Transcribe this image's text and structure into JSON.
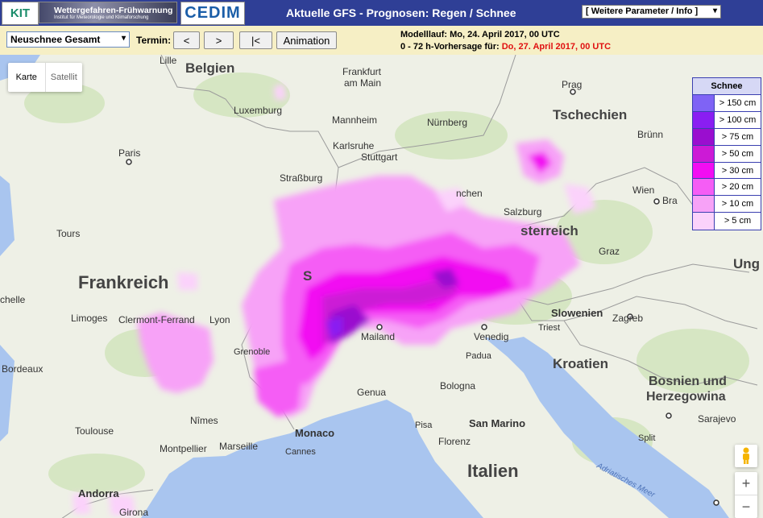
{
  "header": {
    "kit_logo": "KIT",
    "wf_logo": "Wettergefahren-Frühwarnung",
    "wf_sub": "Institut für Meteorologie und Klimaforschung",
    "cedim_logo": "CEDIM",
    "title": "Aktuelle GFS - Prognosen: Regen / Schnee",
    "param_select": "[ Weitere Parameter / Info ]"
  },
  "toolbar": {
    "product_select": "Neuschnee Gesamt",
    "termin_label": "Termin:",
    "btn_prev": "<",
    "btn_next": ">",
    "btn_first": "|<",
    "btn_animation": "Animation",
    "modelllauf_label": "Modelllauf: Mo, 24. April 2017, 00 UTC",
    "vorhersage_label": "0 - 72 h-Vorhersage für:",
    "vorhersage_value": "Do, 27. April 2017, 00 UTC"
  },
  "map": {
    "maptype_karte": "Karte",
    "maptype_satellit": "Satellit",
    "labels": {
      "belgien": "Belgien",
      "lille": "Lille",
      "luxemburg": "Luxemburg",
      "frankfurt1": "Frankfurt",
      "frankfurt2": "am Main",
      "prag": "Prag",
      "tschechien": "Tschechien",
      "mannheim": "Mannheim",
      "nurnberg": "Nürnberg",
      "karlsruhe": "Karlsruhe",
      "stuttgart": "Stuttgart",
      "brunn": "Brünn",
      "paris": "Paris",
      "strassburg": "Straßburg",
      "munchen": "nchen",
      "wien": "Wien",
      "bra": "Bra",
      "salzburg": "Salzburg",
      "osterreich": "sterreich",
      "tours": "Tours",
      "graz": "Graz",
      "ung": "Ung",
      "frankreich": "Frankreich",
      "s": "S",
      "chelle": "chelle",
      "slowenien": "Slowenien",
      "limoges": "Limoges",
      "clermont": "Clermont-Ferrand",
      "lyon": "Lyon",
      "triest": "Triest",
      "zagreb": "Zagreb",
      "venedig": "Venedig",
      "mailand": "Mailand",
      "padua": "Padua",
      "grenoble": "Grenoble",
      "bordeaux": "Bordeaux",
      "kroatien": "Kroatien",
      "bosnien1": "Bosnien und",
      "bosnien2": "Herzegowina",
      "genua": "Genua",
      "bologna": "Bologna",
      "toulouse": "Toulouse",
      "nimes": "Nîmes",
      "pisa": "Pisa",
      "san_marino": "San Marino",
      "sarajevo": "Sarajevo",
      "montpellier": "Montpellier",
      "marseille": "Marseille",
      "monaco": "Monaco",
      "florenz": "Florenz",
      "split": "Split",
      "cannes": "Cannes",
      "italien": "Italien",
      "andorra": "Andorra",
      "girona": "Girona",
      "adria": "Adriatisches Meer"
    }
  },
  "legend": {
    "title": "Schnee",
    "items": [
      {
        "label": "> 150 cm",
        "color": "#7f63f5"
      },
      {
        "label": "> 100 cm",
        "color": "#8a1ef2"
      },
      {
        "label": "> 75 cm",
        "color": "#9a0ecf"
      },
      {
        "label": "> 50 cm",
        "color": "#cc1ad6"
      },
      {
        "label": "> 30 cm",
        "color": "#f20df2"
      },
      {
        "label": "> 20 cm",
        "color": "#f55df5"
      },
      {
        "label": "> 10 cm",
        "color": "#f7a2f7"
      },
      {
        "label": "> 5 cm",
        "color": "#fbd2fb"
      }
    ]
  },
  "controls": {
    "zoom_in": "+",
    "zoom_out": "−"
  }
}
